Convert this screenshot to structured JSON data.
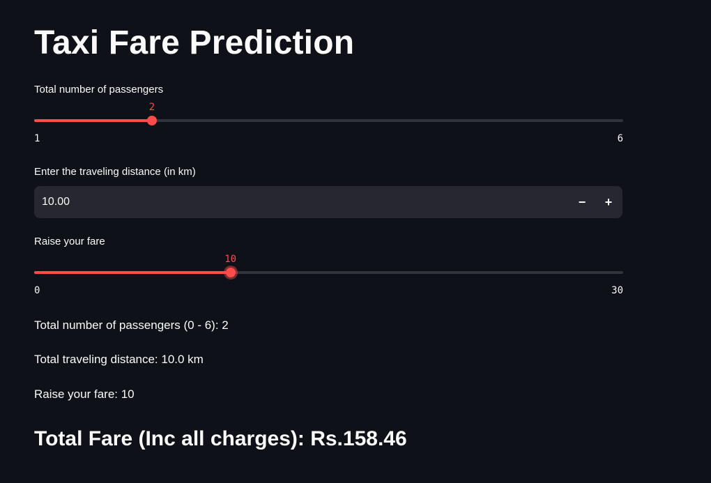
{
  "page": {
    "title": "Taxi Fare Prediction"
  },
  "passengers_slider": {
    "label": "Total number of passengers",
    "min": 1,
    "max": 6,
    "value": 2
  },
  "distance_input": {
    "label": "Enter the traveling distance (in km)",
    "value": "10.00",
    "minus_label": "−",
    "plus_label": "+"
  },
  "fare_slider": {
    "label": "Raise your fare",
    "min": 0,
    "max": 30,
    "value": 10
  },
  "summary": {
    "passengers": "Total number of passengers (0 - 6): 2",
    "distance": "Total traveling distance: 10.0 km",
    "raise": "Raise your fare: 10",
    "total": "Total Fare (Inc all charges): Rs.158.46"
  },
  "colors": {
    "background": "#0e1117",
    "accent": "#ff4b4b",
    "track": "#31333f",
    "input_background": "#262730",
    "text": "#fafafa"
  }
}
